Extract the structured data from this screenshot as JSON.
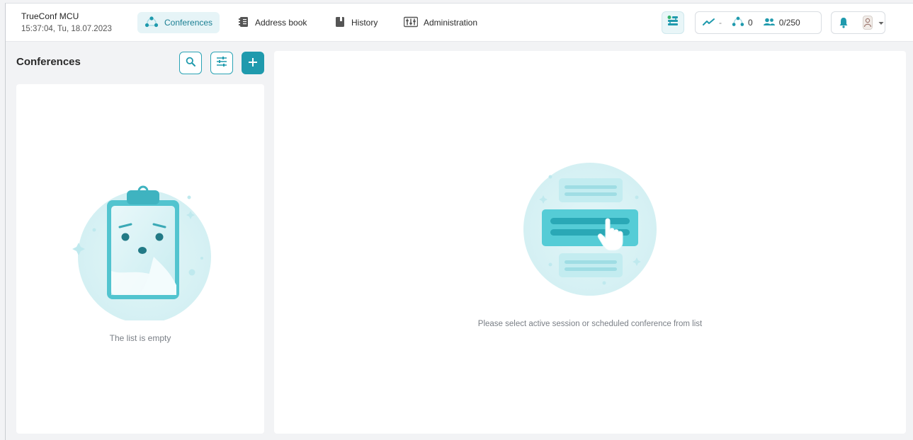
{
  "brand": {
    "app_name": "TrueConf MCU",
    "datetime": "15:37:04, Tu, 18.07.2023"
  },
  "nav": [
    {
      "label": "Conferences",
      "icon": "conferences-icon",
      "active": true
    },
    {
      "label": "Address book",
      "icon": "address-book-icon",
      "active": false
    },
    {
      "label": "History",
      "icon": "history-icon",
      "active": false
    },
    {
      "label": "Administration",
      "icon": "administration-icon",
      "active": false
    }
  ],
  "status": {
    "trend": "-",
    "conferences_count": "0",
    "participants": "0/250"
  },
  "left_panel": {
    "title": "Conferences",
    "empty_text": "The list is empty"
  },
  "right_panel": {
    "hint_text": "Please select active session or scheduled conference from list"
  },
  "colors": {
    "accent": "#1f9aad",
    "accent_light": "#e6f4f7",
    "illustration": "#7fd6df"
  }
}
